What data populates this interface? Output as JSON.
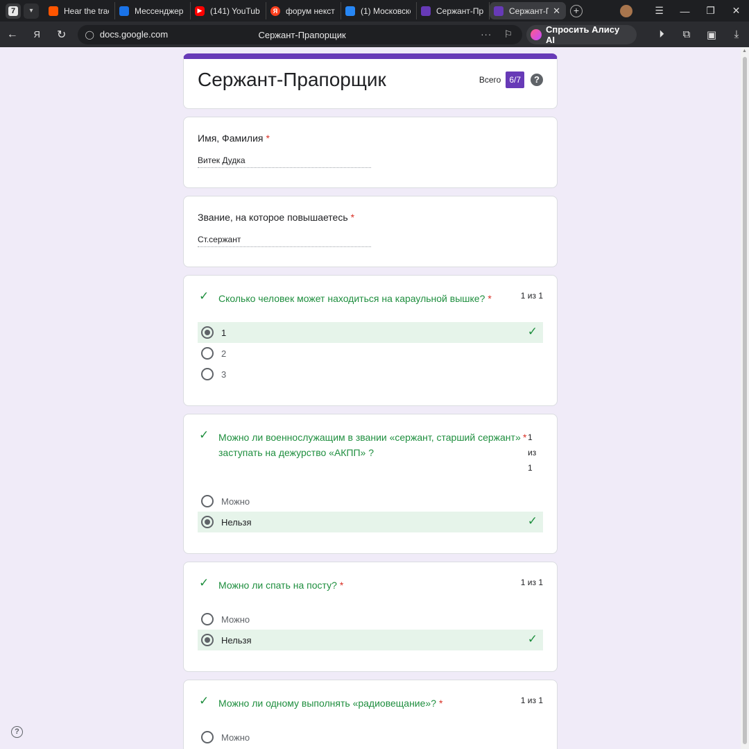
{
  "browser": {
    "tab_counter": "7",
    "tabs": [
      {
        "label": "Hear the track",
        "fav_color": "#ff5500"
      },
      {
        "label": "Мессенджер",
        "fav_color": "#1a73e8"
      },
      {
        "label": "(141) YouTube",
        "fav_color": "#ff0000"
      },
      {
        "label": "форум некст",
        "fav_color": "#fc3f1d"
      },
      {
        "label": "(1) Московско",
        "fav_color": "#2787f5"
      },
      {
        "label": "Сержант-Пра",
        "fav_color": "#673ab7"
      },
      {
        "label": "Сержант-П",
        "fav_color": "#673ab7"
      }
    ],
    "url": "docs.google.com",
    "page_title": "Сержант-Прапорщик",
    "alisa_label": "Спросить Алису AI"
  },
  "form": {
    "title": "Сержант-Прапорщик",
    "score_label": "Всего",
    "score": "6/7"
  },
  "fields": [
    {
      "label": "Имя, Фамилия",
      "value": "Витек Дудка"
    },
    {
      "label": "Звание, на которое повышаетесь",
      "value": "Ст.сержант"
    }
  ],
  "questions": [
    {
      "text": "Сколько человек может находиться на караульной вышке?",
      "points": "1 из 1",
      "options": [
        "1",
        "2",
        "3"
      ]
    },
    {
      "text_line1": "Можно ли военнослужащим в звании «сержант, старший сержант»",
      "text_line2": "заступать на дежурство «АКПП» ?",
      "points_l1": "1",
      "points_l2": "из",
      "points_l3": "1",
      "options": [
        "Можно",
        "Нельзя"
      ]
    },
    {
      "text": "Можно ли спать на посту?",
      "points": "1 из 1",
      "options": [
        "Можно",
        "Нельзя"
      ]
    },
    {
      "text": "Можно ли одному выполнять «радиовещание»?",
      "points": "1 из 1",
      "options": [
        "Можно"
      ]
    }
  ],
  "required_mark": "*"
}
